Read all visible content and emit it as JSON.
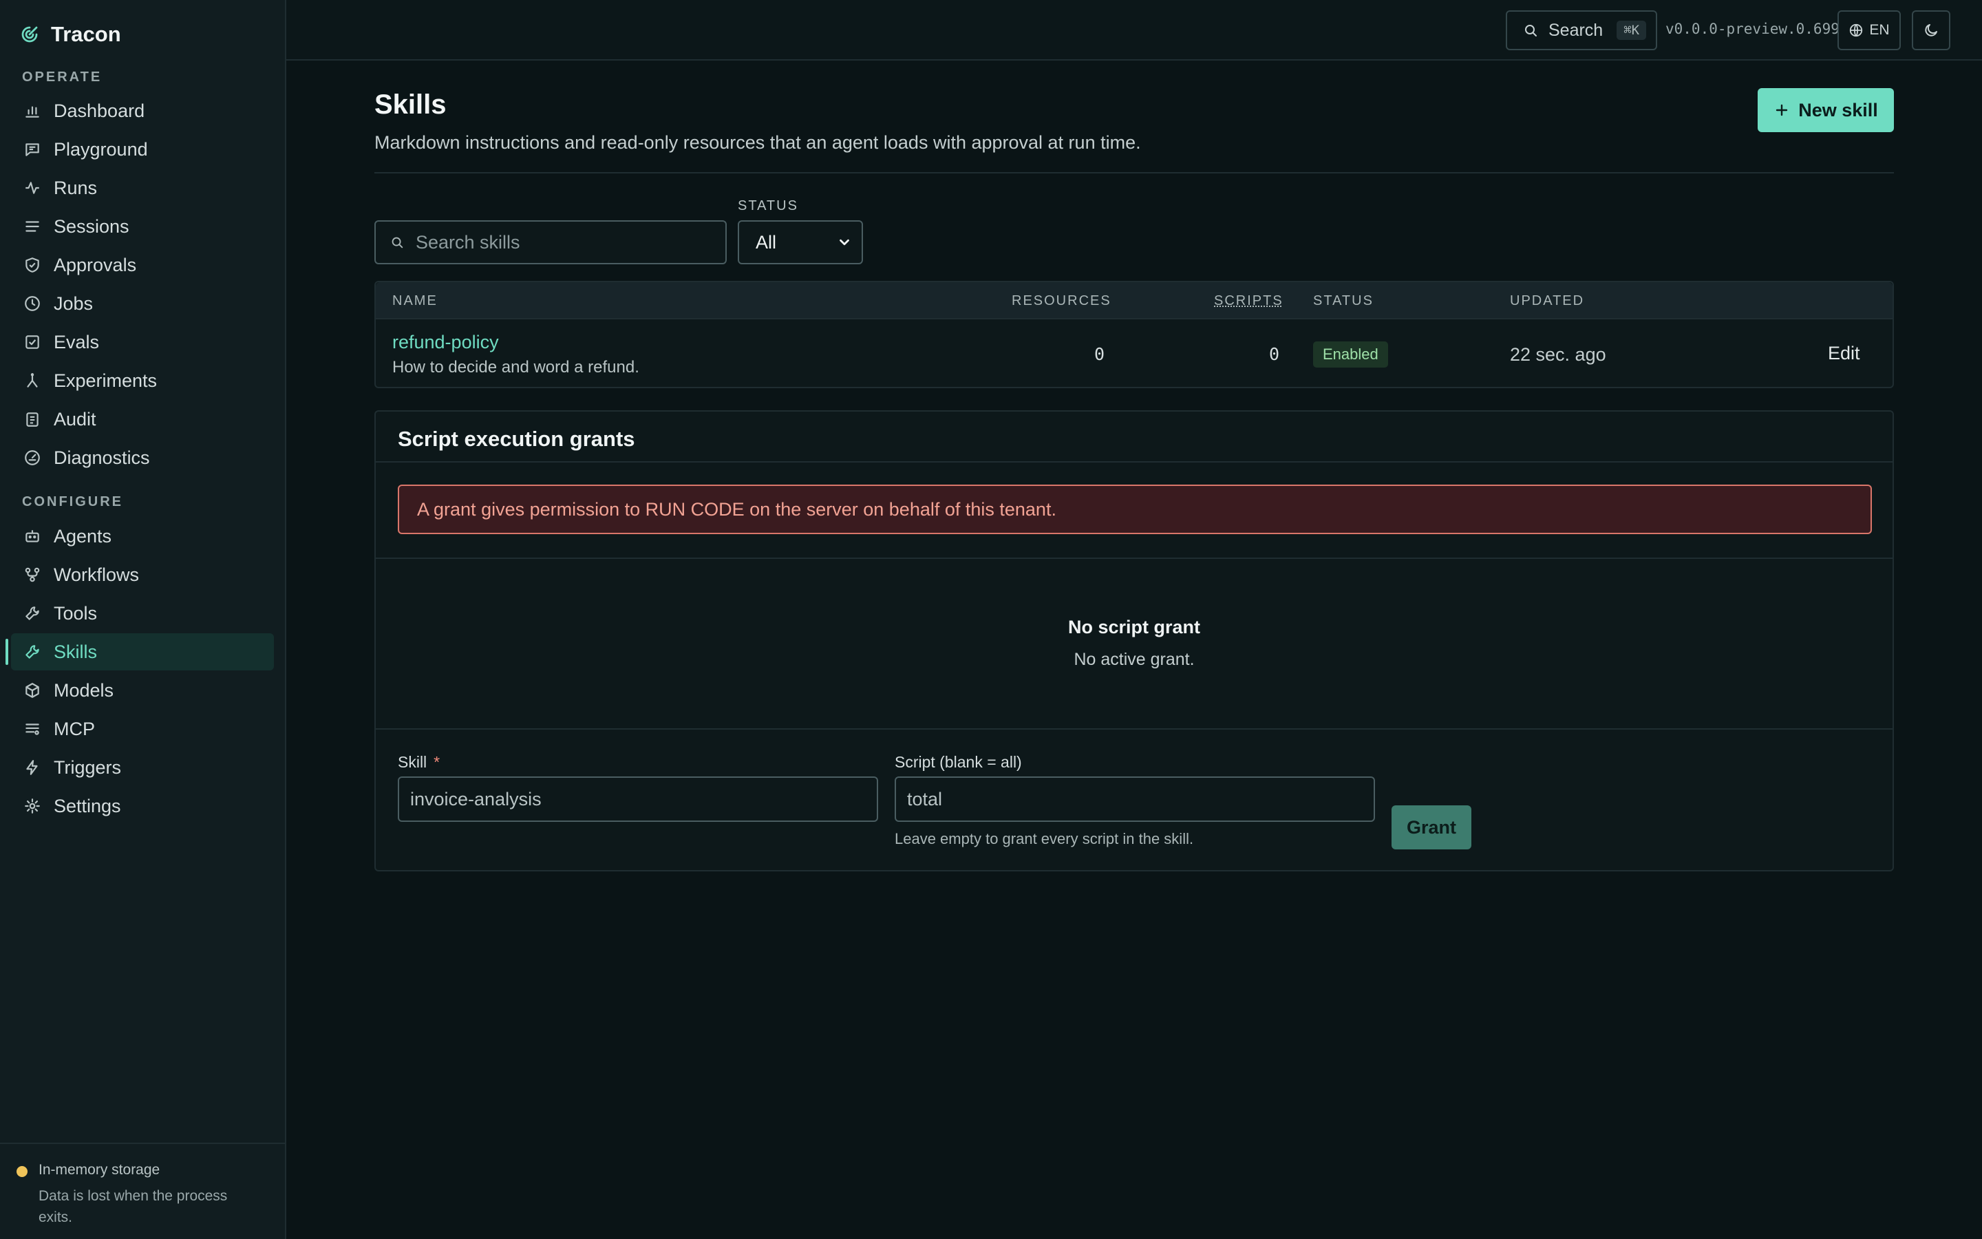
{
  "app": {
    "name": "Tracon"
  },
  "sidebar": {
    "sections": [
      {
        "label": "OPERATE"
      },
      {
        "label": "CONFIGURE"
      }
    ],
    "items": [
      {
        "label": "Dashboard",
        "icon": "bar-chart-icon"
      },
      {
        "label": "Playground",
        "icon": "chat-icon"
      },
      {
        "label": "Runs",
        "icon": "activity-icon"
      },
      {
        "label": "Sessions",
        "icon": "list-icon"
      },
      {
        "label": "Approvals",
        "icon": "shield-check-icon"
      },
      {
        "label": "Jobs",
        "icon": "clock-icon"
      },
      {
        "label": "Evals",
        "icon": "checkbox-icon"
      },
      {
        "label": "Experiments",
        "icon": "flask-icon"
      },
      {
        "label": "Audit",
        "icon": "clipboard-icon"
      },
      {
        "label": "Diagnostics",
        "icon": "gauge-icon"
      },
      {
        "label": "Agents",
        "icon": "bot-icon"
      },
      {
        "label": "Workflows",
        "icon": "workflow-icon"
      },
      {
        "label": "Tools",
        "icon": "wrench-icon"
      },
      {
        "label": "Skills",
        "icon": "skill-icon",
        "active": true
      },
      {
        "label": "Models",
        "icon": "cube-icon"
      },
      {
        "label": "MCP",
        "icon": "server-icon"
      },
      {
        "label": "Triggers",
        "icon": "lightning-icon"
      },
      {
        "label": "Settings",
        "icon": "gear-icon"
      }
    ],
    "footer": {
      "title": "In-memory storage",
      "description": "Data is lost when the process exits."
    }
  },
  "topbar": {
    "search_label": "Search",
    "search_shortcut": "⌘K",
    "version": "v0.0.0-preview.0.699",
    "language": "EN"
  },
  "page": {
    "title": "Skills",
    "subtitle": "Markdown instructions and read-only resources that an agent loads with approval at run time.",
    "new_button": "New skill"
  },
  "filters": {
    "search_placeholder": "Search skills",
    "status_label": "STATUS",
    "status_value": "All"
  },
  "table": {
    "columns": [
      "NAME",
      "RESOURCES",
      "SCRIPTS",
      "STATUS",
      "UPDATED"
    ],
    "rows": [
      {
        "name": "refund-policy",
        "description": "How to decide and word a refund.",
        "resources": "0",
        "scripts": "0",
        "status": "Enabled",
        "updated": "22 sec. ago",
        "action": "Edit"
      }
    ]
  },
  "grants": {
    "title": "Script execution grants",
    "warning": "A grant gives permission to RUN CODE on the server on behalf of this tenant.",
    "empty_title": "No script grant",
    "empty_subtitle": "No active grant.",
    "skill_label": "Skill",
    "required_mark": "*",
    "skill_value": "invoice-analysis",
    "script_label": "Script (blank = all)",
    "script_value": "total",
    "script_hint": "Leave empty to grant every script in the skill.",
    "grant_button": "Grant"
  },
  "colors": {
    "accent": "#6fdcc2",
    "background": "#0a1416",
    "sidebar": "#111d20",
    "danger_border": "#d9766a",
    "danger_text": "#f2a394",
    "status_enabled": "#9ee0a8"
  }
}
